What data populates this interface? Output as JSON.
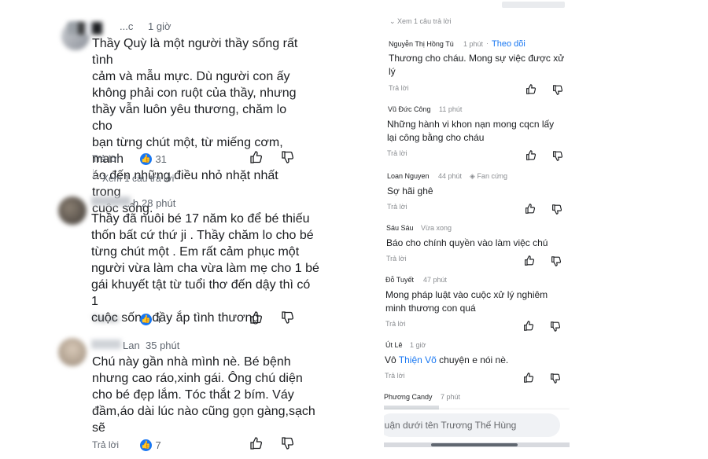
{
  "left": {
    "comment1": {
      "name": "...c",
      "time": "1 giờ",
      "text": [
        "Thầy Quỳ là một người thầy sống rất tình",
        "cảm và mẫu mực. Dù người con ấy",
        "không phải con ruột của thầy, nhưng",
        "thầy vẫn luôn yêu thương, chăm lo cho",
        "bạn từng chút một, từ miếng cơm, manh",
        "áo đến những điều nhỏ nhặt nhất trong",
        "cuộc sống."
      ],
      "reply": "Trả lời",
      "likes": "31",
      "view_replies": "Xem 1 câu trả lời"
    },
    "comment2": {
      "name": "...h",
      "time": "28 phút",
      "text": [
        "Thầy đã nuôi bé 17 năm ko để bé thiếu",
        "thốn bất cứ thứ ji . Thầy chăm lo cho bé",
        "từng chút một . Em rất cảm phục một",
        "người vừa làm cha vừa làm mẹ cho 1 bé",
        "gái khuyết tật từ tuổi thơ đến dậy thì có 1",
        "cuộc sống đầy ắp tình thương"
      ],
      "reply": "Trả lời",
      "likes": "4"
    },
    "comment3": {
      "name": "Lan",
      "time": "35 phút",
      "text": [
        "Chú này gần nhà mình nè. Bé bệnh",
        "nhưng cao ráo,xinh gái. Ông chú diện",
        "cho bé đẹp lắm. Tóc thắt 2 bím. Váy",
        "đầm,áo dài lúc nào cũng gọn gàng,sạch",
        "sẽ"
      ],
      "reply": "Trả lời",
      "likes": "7"
    }
  },
  "right": {
    "top_view_replies": "Xem 1 câu trả lời",
    "comments": [
      {
        "name": "Nguyễn Thị Hồng Tú",
        "time": "1 phút",
        "follow": "Theo dõi",
        "text": [
          "Thương cho cháu. Mong sự việc được xử",
          "lý"
        ],
        "reply": "Trả lời"
      },
      {
        "name": "Vũ Đức Công",
        "time": "11 phút",
        "text": [
          "Những hành vi khon nạn mong cqcn lấy",
          "lại công bằng cho cháu"
        ],
        "reply": "Trả lời"
      },
      {
        "name": "Loan Nguyen",
        "time": "44 phút",
        "badge": "Fan cứng",
        "text": [
          "Sợ hãi ghê"
        ],
        "reply": "Trả lời"
      },
      {
        "name": "Sáu Sáu",
        "time": "Vừa xong",
        "text": [
          "Báo cho chính quyền vào làm việc chú"
        ],
        "reply": "Trả lời"
      },
      {
        "name": "Đỗ Tuyết",
        "time": "47 phút",
        "text": [
          "Mong pháp luật vào cuộc xử lý nghiêm",
          "minh  thương con quá"
        ],
        "reply": "Trả lời"
      },
      {
        "name": "Út Lê",
        "time": "1 giờ",
        "text_prefix": "Vô ",
        "mention": "Thiện Võ",
        "text_suffix": " chuyện e nói nè.",
        "reply": "Trả lời"
      },
      {
        "name": "Phương Candy",
        "time": "7 phút"
      }
    ],
    "input_placeholder": "luận dưới tên Trương Thế Hùng"
  }
}
